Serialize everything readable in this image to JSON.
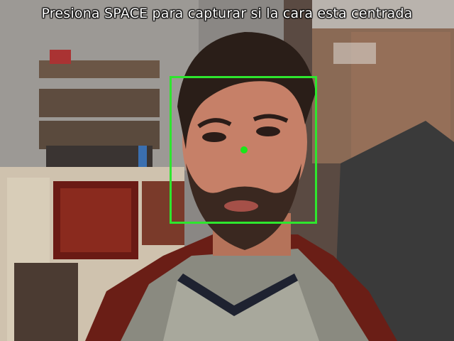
{
  "overlay": {
    "instruction": "Presiona SPACE para capturar si la cara esta centrada",
    "box_color": "#2ee62e",
    "dot_color": "#19e619"
  },
  "scene": {
    "description_icon": "webcam-frame"
  }
}
